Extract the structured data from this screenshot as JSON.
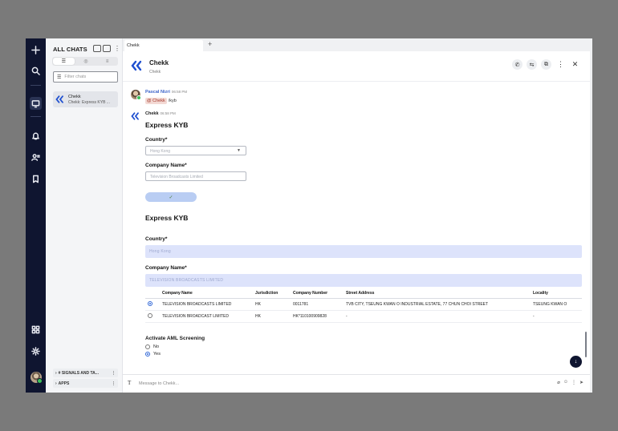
{
  "sidebar": {
    "title": "ALL CHATS",
    "filter_placeholder": "Filter chats",
    "chat_item": {
      "name": "Chekk",
      "subtitle": "Chekk: Express KYB ..."
    },
    "sections": [
      {
        "label": "# SIGNALS AND TA..."
      },
      {
        "label": "APPS"
      }
    ]
  },
  "tab": {
    "label": "Chekk",
    "add": "+"
  },
  "cursor_text": "g",
  "header": {
    "title": "Chekk",
    "subtitle": "Chekk"
  },
  "messages": {
    "pascal": {
      "sender": "Pascal Nizri",
      "time": "06:58 PM",
      "mention": "@ Chekk",
      "text": "/kyb"
    },
    "chekk": {
      "sender": "Chekk",
      "time": "06:58 PM"
    }
  },
  "form": {
    "title": "Express KYB",
    "country_label": "Country*",
    "country_value": "Hong Kong",
    "company_label": "Company Name*",
    "company_value": "Television Broadcasts Limited",
    "submit_glyph": "✓"
  },
  "result": {
    "title": "Express KYB",
    "country_label": "Country*",
    "country_value": "Hong Kong",
    "company_label": "Company Name*",
    "company_value": "TELEVISION BROADCASTS LIMITED"
  },
  "table": {
    "headers": [
      "",
      "Company Name",
      "Jurisdiction",
      "Company Number",
      "Street Address",
      "Locality"
    ],
    "rows": [
      {
        "selected": true,
        "name": "TELEVISION BROADCASTS LIMITED",
        "jurisdiction": "HK",
        "number": "0011781",
        "address": "TVB CITY, TSEUNG KWAN O INDUSTRIAL ESTATE, 77 CHUN CHOI STREET",
        "locality": "TSEUNG KWAN O"
      },
      {
        "selected": false,
        "name": "TELEVISION BROADCAST LIMITED",
        "jurisdiction": "HK",
        "number": "HK*110100909828",
        "address": "-",
        "locality": "-"
      }
    ]
  },
  "aml": {
    "title": "Activate AML Screening",
    "options": [
      {
        "label": "No",
        "selected": false
      },
      {
        "label": "Yes",
        "selected": true
      }
    ]
  },
  "composer": {
    "placeholder": "Message to Chekk..."
  },
  "colors": {
    "rail": "#0f1530",
    "accent": "#2f66d6",
    "link": "#3b63c9",
    "filled_field": "#dde3fb"
  }
}
